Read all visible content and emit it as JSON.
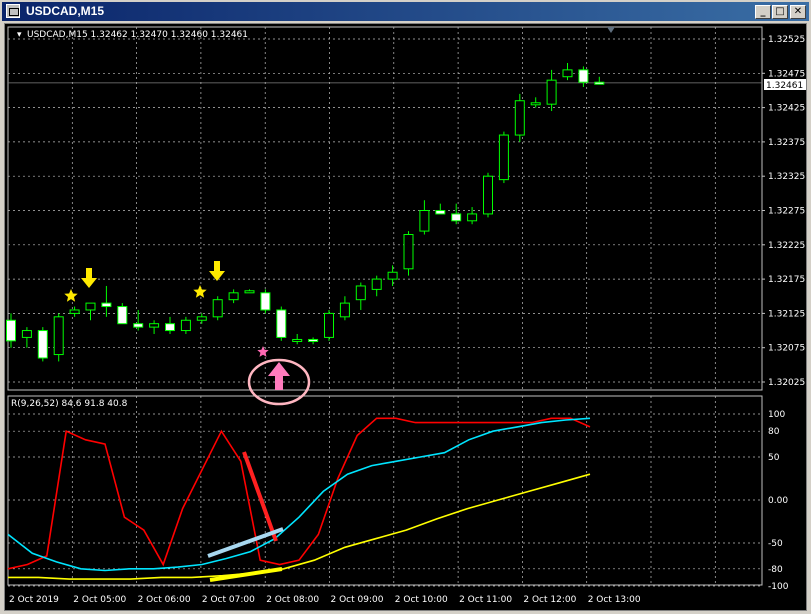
{
  "window": {
    "title": "USDCAD,M15"
  },
  "title_buttons": {
    "minimize": "_",
    "maximize": "□",
    "close": "✕"
  },
  "info_line": "USDCAD,M15  1.32462 1.32470 1.32460 1.32461",
  "indicator_label": "R(9,26,52) 84.6 91.8 40.8",
  "current_price": "1.32461",
  "price_axis": [
    "1.32525",
    "1.32475",
    "1.32425",
    "1.32375",
    "1.32325",
    "1.32275",
    "1.32225",
    "1.32175",
    "1.32125",
    "1.32075",
    "1.32025"
  ],
  "ind_axis": [
    "100",
    "80",
    "50",
    "0.00",
    "-50",
    "-80",
    "-100"
  ],
  "time_axis": [
    "2 Oct 2019",
    "2 Oct 05:00",
    "2 Oct 06:00",
    "2 Oct 07:00",
    "2 Oct 08:00",
    "2 Oct 09:00",
    "2 Oct 10:00",
    "2 Oct 11:00",
    "2 Oct 12:00",
    "2 Oct 13:00"
  ],
  "colors": {
    "background": "#000000",
    "grid": "#c0c0c0",
    "candle": "#00ff00",
    "bull_body": "#000000",
    "bear_body": "#ffffff",
    "axis_text": "#ffffff",
    "red_line": "#ff0000",
    "cyan_line": "#00e5ff",
    "yellow_line": "#ffff00",
    "arrow_down": "#ffea00",
    "star_yellow": "#ffea00",
    "arrow_up": "#ff7bbd",
    "star_pink": "#ff69b4",
    "circle": "#ffb6c1",
    "annot_red": "#ff2020",
    "annot_cyan": "#a8d8f0",
    "annot_yellow": "#ffff00"
  },
  "chart_data": {
    "type": "candlestick",
    "symbol": "USDCAD",
    "timeframe": "M15",
    "candles": [
      {
        "o": 1.32115,
        "h": 1.32125,
        "l": 1.32075,
        "c": 1.32085
      },
      {
        "o": 1.3209,
        "h": 1.32105,
        "l": 1.32075,
        "c": 1.321
      },
      {
        "o": 1.321,
        "h": 1.32105,
        "l": 1.32055,
        "c": 1.3206
      },
      {
        "o": 1.32065,
        "h": 1.32125,
        "l": 1.32055,
        "c": 1.3212
      },
      {
        "o": 1.32125,
        "h": 1.32135,
        "l": 1.3212,
        "c": 1.3213
      },
      {
        "o": 1.3213,
        "h": 1.3214,
        "l": 1.32115,
        "c": 1.3214
      },
      {
        "o": 1.3214,
        "h": 1.32165,
        "l": 1.3212,
        "c": 1.32135
      },
      {
        "o": 1.32135,
        "h": 1.3214,
        "l": 1.3211,
        "c": 1.3211
      },
      {
        "o": 1.3211,
        "h": 1.3213,
        "l": 1.321,
        "c": 1.32105
      },
      {
        "o": 1.32105,
        "h": 1.32115,
        "l": 1.32095,
        "c": 1.3211
      },
      {
        "o": 1.3211,
        "h": 1.3212,
        "l": 1.32095,
        "c": 1.321
      },
      {
        "o": 1.321,
        "h": 1.3212,
        "l": 1.32095,
        "c": 1.32115
      },
      {
        "o": 1.32115,
        "h": 1.32125,
        "l": 1.3211,
        "c": 1.3212
      },
      {
        "o": 1.3212,
        "h": 1.3215,
        "l": 1.32115,
        "c": 1.32145
      },
      {
        "o": 1.32145,
        "h": 1.3216,
        "l": 1.3214,
        "c": 1.32155
      },
      {
        "o": 1.32155,
        "h": 1.3216,
        "l": 1.32155,
        "c": 1.32158
      },
      {
        "o": 1.32155,
        "h": 1.3216,
        "l": 1.32125,
        "c": 1.3213
      },
      {
        "o": 1.3213,
        "h": 1.32135,
        "l": 1.32085,
        "c": 1.3209
      },
      {
        "o": 1.32085,
        "h": 1.32095,
        "l": 1.3208,
        "c": 1.32087
      },
      {
        "o": 1.32087,
        "h": 1.3209,
        "l": 1.3208,
        "c": 1.32085
      },
      {
        "o": 1.3209,
        "h": 1.3213,
        "l": 1.32085,
        "c": 1.32125
      },
      {
        "o": 1.3212,
        "h": 1.3215,
        "l": 1.32115,
        "c": 1.3214
      },
      {
        "o": 1.32145,
        "h": 1.3217,
        "l": 1.3213,
        "c": 1.32165
      },
      {
        "o": 1.3216,
        "h": 1.3218,
        "l": 1.3215,
        "c": 1.32175
      },
      {
        "o": 1.32175,
        "h": 1.32195,
        "l": 1.32165,
        "c": 1.32185
      },
      {
        "o": 1.3219,
        "h": 1.32245,
        "l": 1.3218,
        "c": 1.3224
      },
      {
        "o": 1.32245,
        "h": 1.3229,
        "l": 1.3224,
        "c": 1.32275
      },
      {
        "o": 1.32275,
        "h": 1.32285,
        "l": 1.3227,
        "c": 1.3227
      },
      {
        "o": 1.3227,
        "h": 1.32285,
        "l": 1.32255,
        "c": 1.3226
      },
      {
        "o": 1.3226,
        "h": 1.3228,
        "l": 1.32255,
        "c": 1.3227
      },
      {
        "o": 1.3227,
        "h": 1.3233,
        "l": 1.32265,
        "c": 1.32325
      },
      {
        "o": 1.3232,
        "h": 1.3239,
        "l": 1.32315,
        "c": 1.32385
      },
      {
        "o": 1.32385,
        "h": 1.32445,
        "l": 1.32375,
        "c": 1.32435
      },
      {
        "o": 1.3243,
        "h": 1.3244,
        "l": 1.32425,
        "c": 1.32432
      },
      {
        "o": 1.3243,
        "h": 1.3248,
        "l": 1.3242,
        "c": 1.32465
      },
      {
        "o": 1.3247,
        "h": 1.3249,
        "l": 1.32465,
        "c": 1.3248
      },
      {
        "o": 1.3248,
        "h": 1.32485,
        "l": 1.32455,
        "c": 1.32462
      },
      {
        "o": 1.32462,
        "h": 1.3247,
        "l": 1.3246,
        "c": 1.32461
      }
    ],
    "indicator": {
      "name": "R(9,26,52)",
      "values": [
        84.6,
        91.8,
        40.8
      ],
      "ylim": [
        -100,
        100
      ],
      "series": [
        {
          "name": "9",
          "values": [
            -80,
            -75,
            -65,
            80,
            70,
            65,
            -20,
            -35,
            -75,
            -10,
            35,
            80,
            45,
            -70,
            -75,
            -70,
            -40,
            25,
            75,
            95,
            95,
            90,
            90,
            90,
            90,
            90,
            90,
            90,
            95,
            95,
            85
          ]
        },
        {
          "name": "26",
          "values": [
            -40,
            -62,
            -72,
            -80,
            -82,
            -80,
            -80,
            -78,
            -75,
            -68,
            -60,
            -45,
            -20,
            10,
            30,
            40,
            45,
            50,
            55,
            70,
            80,
            85,
            90,
            93,
            95
          ]
        },
        {
          "name": "52",
          "values": [
            -90,
            -90,
            -92,
            -92,
            -92,
            -90,
            -90,
            -88,
            -85,
            -80,
            -70,
            -55,
            -45,
            -35,
            -22,
            -10,
            0,
            10,
            20,
            30
          ]
        }
      ]
    }
  }
}
